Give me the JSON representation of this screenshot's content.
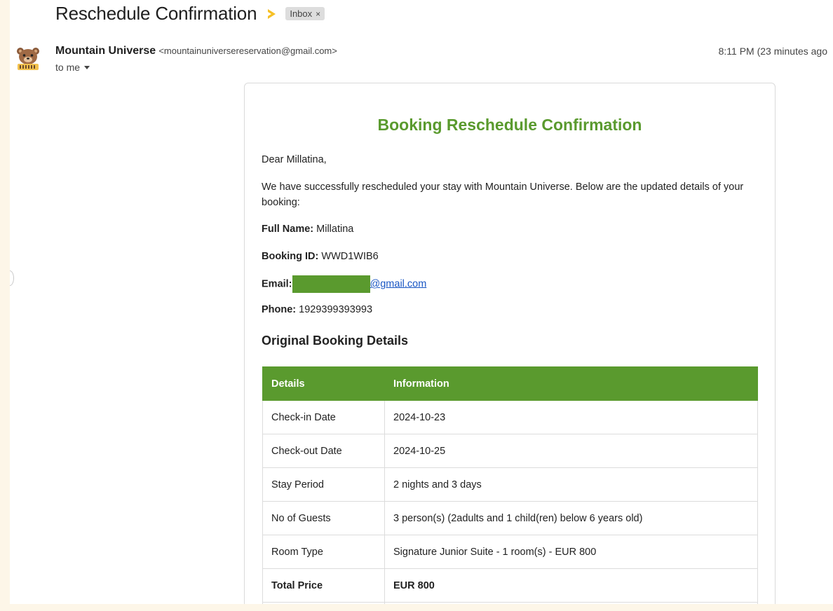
{
  "email": {
    "subject": "Reschedule Confirmation",
    "label": "Inbox",
    "label_close": "×",
    "sender_name": "Mountain Universe",
    "sender_email": "<mountainuniversereservation@gmail.com>",
    "recipient": "to me",
    "timestamp": "8:11 PM (23 minutes ago"
  },
  "body": {
    "title": "Booking Reschedule Confirmation",
    "greeting": "Dear Millatina,",
    "intro": "We have successfully rescheduled your stay with Mountain Universe. Below are the updated details of your booking:",
    "full_name_label": "Full Name:",
    "full_name": "Millatina",
    "booking_id_label": "Booking ID:",
    "booking_id": "WWD1WIB6",
    "email_label": "Email:",
    "email_suffix": "@gmail.com",
    "phone_label": "Phone:",
    "phone": "1929399393993",
    "section_heading": "Original Booking Details",
    "table": {
      "headers": [
        "Details",
        "Information"
      ],
      "rows": [
        [
          "Check-in Date",
          "2024-10-23"
        ],
        [
          "Check-out Date",
          "2024-10-25"
        ],
        [
          "Stay Period",
          "2 nights and 3 days"
        ],
        [
          "No of Guests",
          "3 person(s) (2adults and 1 child(ren) below 6 years old)"
        ],
        [
          "Room Type",
          "Signature Junior Suite - 1 room(s) - EUR 800"
        ],
        [
          "Total Price",
          "EUR 800"
        ]
      ]
    }
  },
  "colors": {
    "accent_green": "#5a9a2e",
    "importance_marker": "#f6c026",
    "link": "#1a57c4"
  },
  "icons": {
    "avatar": "bear-avatar-icon",
    "importance": "importance-marker-icon",
    "dropdown": "caret-down-icon"
  }
}
